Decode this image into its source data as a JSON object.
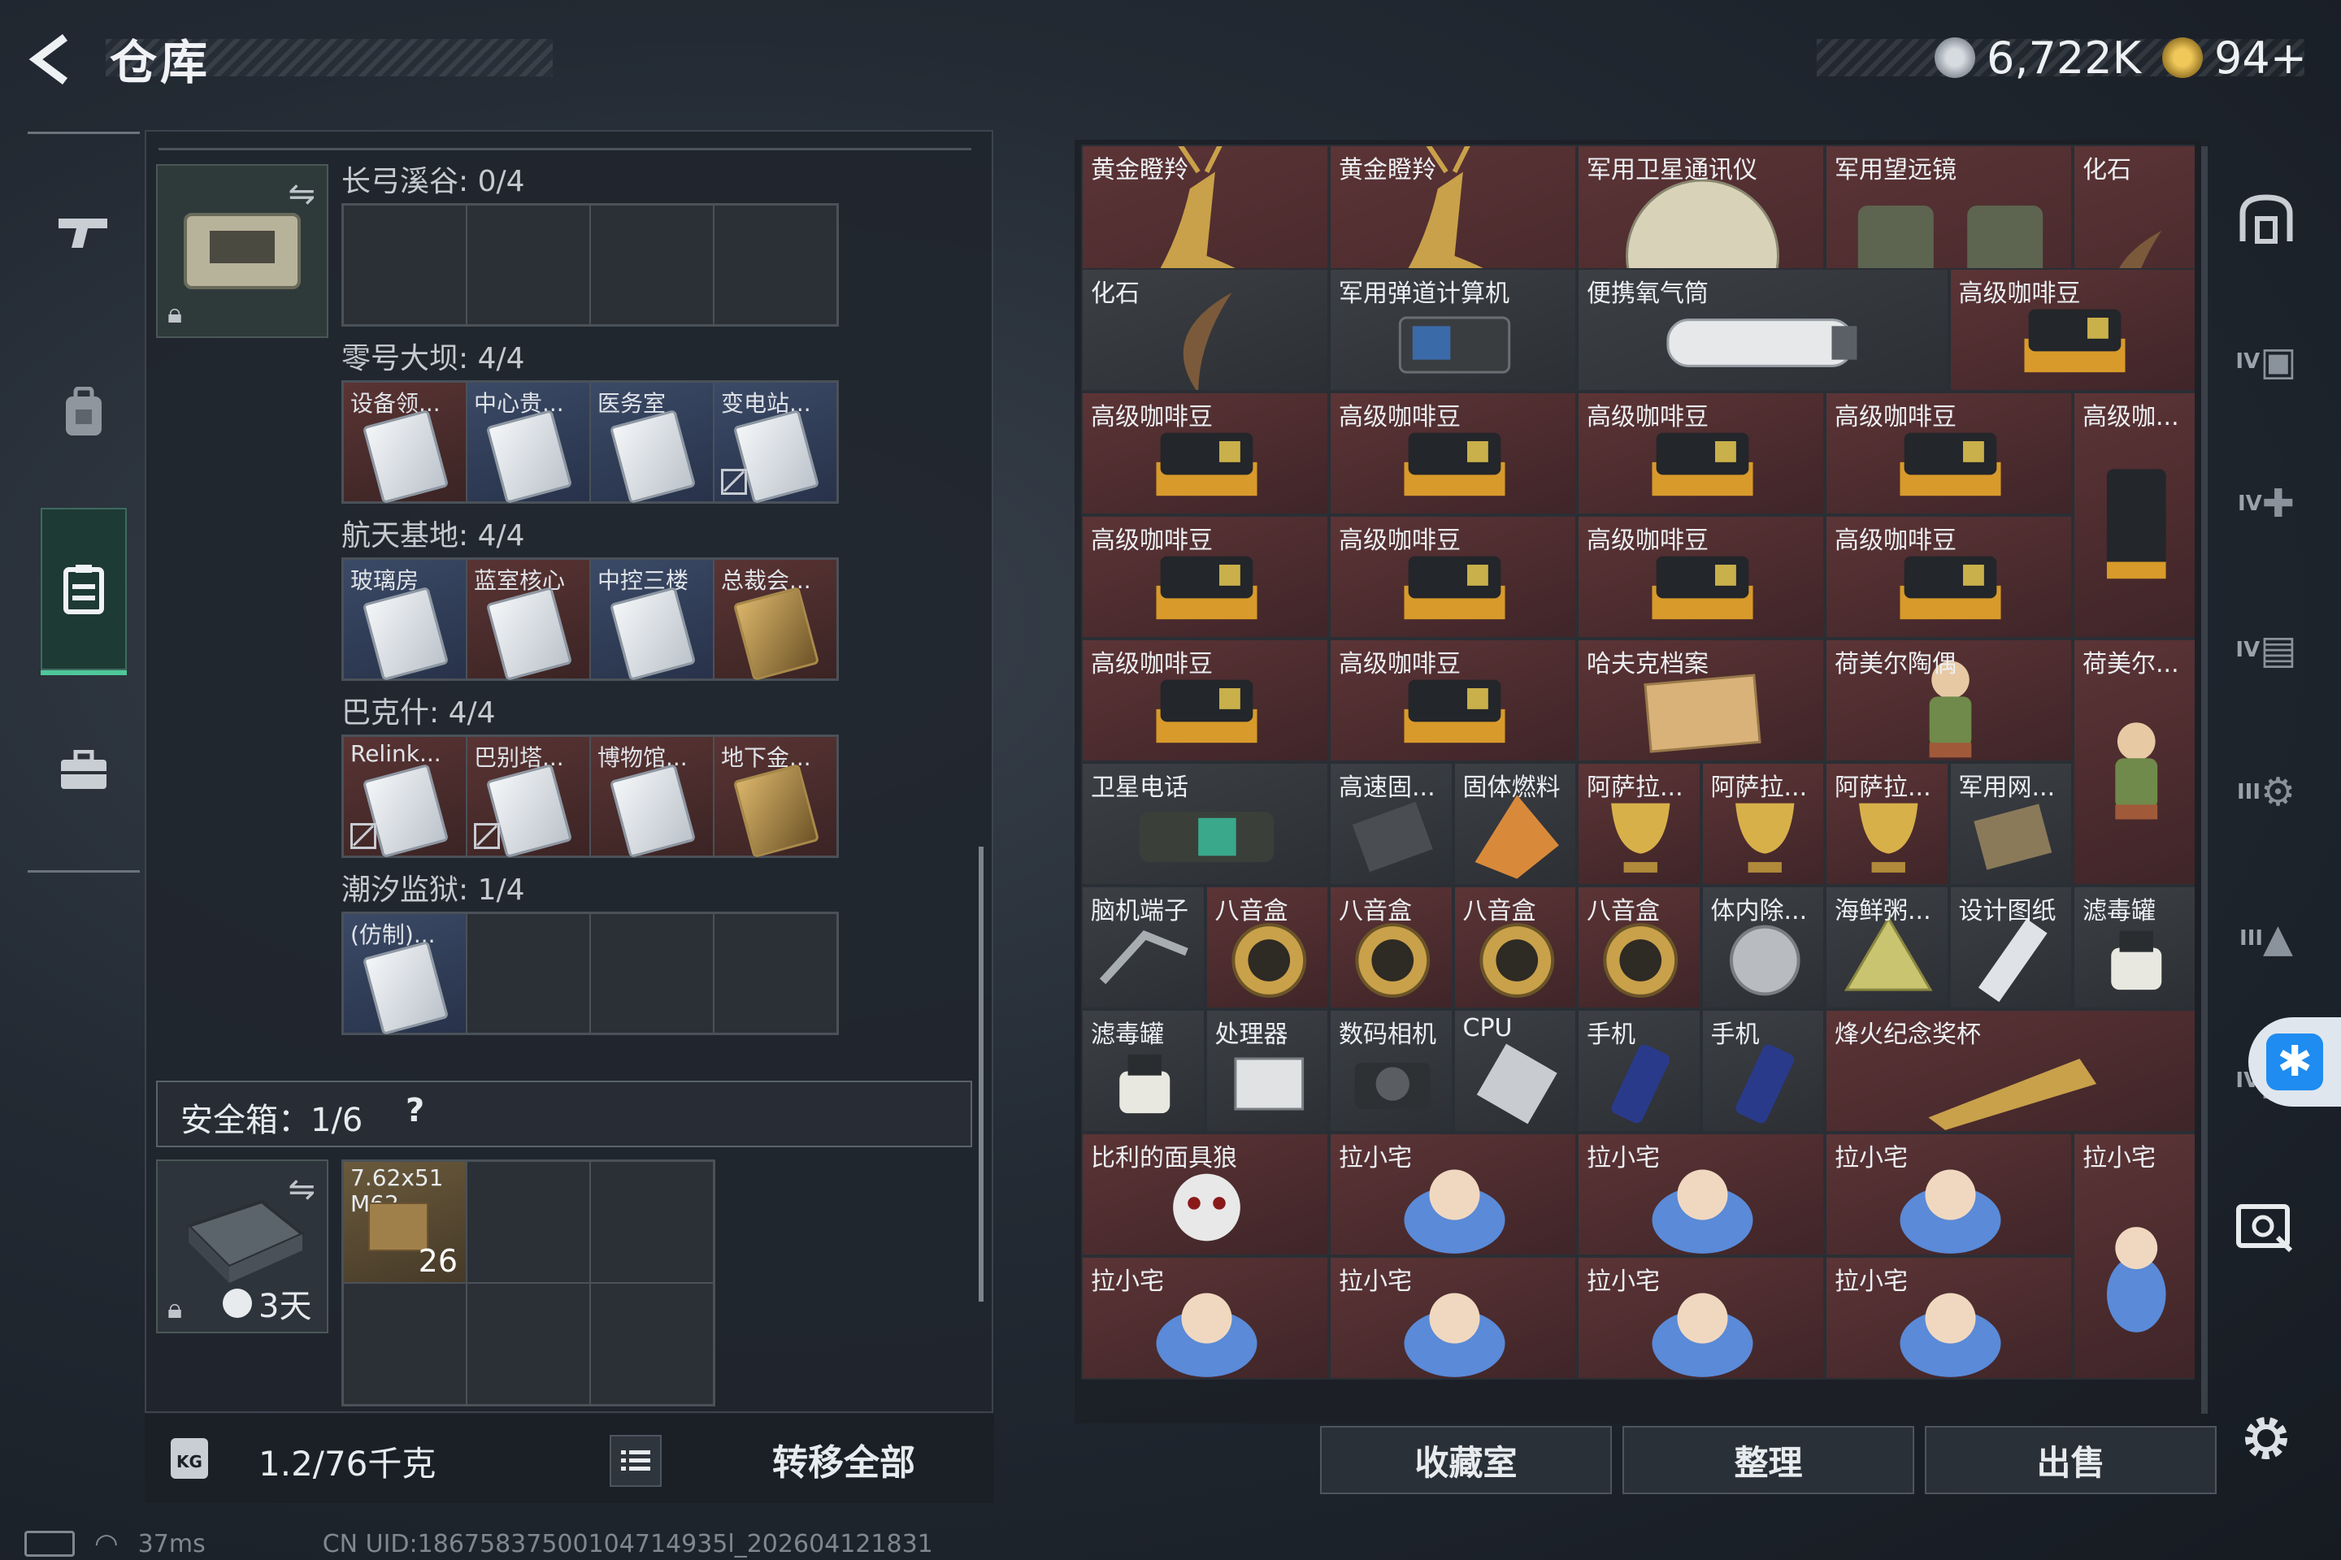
{
  "header": {
    "title": "仓库",
    "currency1": "6,722K",
    "currency2": "94+"
  },
  "storage": {
    "sections": [
      {
        "name": "长弓溪谷: 0/4",
        "slots": [
          {
            "label": ""
          },
          {
            "label": ""
          },
          {
            "label": ""
          },
          {
            "label": ""
          }
        ]
      },
      {
        "name": "零号大坝: 4/4",
        "slots": [
          {
            "label": "设备领..."
          },
          {
            "label": "中心贵..."
          },
          {
            "label": "医务室"
          },
          {
            "label": "变电站..."
          }
        ]
      },
      {
        "name": "航天基地: 4/4",
        "slots": [
          {
            "label": "玻璃房"
          },
          {
            "label": "蓝室核心"
          },
          {
            "label": "中控三楼"
          },
          {
            "label": "总裁会..."
          }
        ]
      },
      {
        "name": "巴克什: 4/4",
        "slots": [
          {
            "label": "Relink..."
          },
          {
            "label": "巴别塔..."
          },
          {
            "label": "博物馆..."
          },
          {
            "label": "地下金..."
          }
        ]
      },
      {
        "name": "潮汐监狱: 1/4",
        "slots": [
          {
            "label": "(仿制)..."
          },
          {
            "label": ""
          },
          {
            "label": ""
          },
          {
            "label": ""
          }
        ]
      }
    ],
    "safe_box": {
      "label": "安全箱：1/6",
      "help": "?",
      "timer": "3天",
      "ammo_name": "7.62x51 M62",
      "ammo_count": "26"
    },
    "weight": "1.2/76千克",
    "transfer_all": "转移全部"
  },
  "inventory": {
    "items": [
      {
        "name": "黄金瞪羚",
        "icon": "golden-gazelle"
      },
      {
        "name": "黄金瞪羚",
        "icon": "golden-gazelle"
      },
      {
        "name": "军用卫星通讯仪",
        "icon": "satellite-device"
      },
      {
        "name": "军用望远镜",
        "icon": "binoculars"
      },
      {
        "name": "化石",
        "icon": "fossil-claw"
      },
      {
        "name": "化石",
        "icon": "fossil-claw"
      },
      {
        "name": "军用弹道计算机",
        "icon": "ballistic-computer"
      },
      {
        "name": "便携氧气筒",
        "icon": "oxygen-tank"
      },
      {
        "name": "高级咖啡豆",
        "icon": "coffee-bag"
      },
      {
        "name": "高级咖啡豆",
        "icon": "coffee-bag"
      },
      {
        "name": "高级咖啡豆",
        "icon": "coffee-bag"
      },
      {
        "name": "高级咖啡豆",
        "icon": "coffee-bag"
      },
      {
        "name": "高级咖啡豆",
        "icon": "coffee-bag"
      },
      {
        "name": "高级咖...",
        "icon": "coffee-bag-tall"
      },
      {
        "name": "高级咖啡豆",
        "icon": "coffee-bag"
      },
      {
        "name": "高级咖啡豆",
        "icon": "coffee-bag"
      },
      {
        "name": "高级咖啡豆",
        "icon": "coffee-bag"
      },
      {
        "name": "高级咖啡豆",
        "icon": "coffee-bag"
      },
      {
        "name": "高级咖啡豆",
        "icon": "coffee-bag"
      },
      {
        "name": "高级咖啡豆",
        "icon": "coffee-bag"
      },
      {
        "name": "哈夫克档案",
        "icon": "file-folder"
      },
      {
        "name": "荷美尔陶偶",
        "icon": "ceramic-figure"
      },
      {
        "name": "荷美尔...",
        "icon": "ceramic-figure"
      },
      {
        "name": "卫星电话",
        "icon": "satellite-phone"
      },
      {
        "name": "高速固...",
        "icon": "ssd"
      },
      {
        "name": "固体燃料",
        "icon": "solid-fuel"
      },
      {
        "name": "阿萨拉...",
        "icon": "gold-cup"
      },
      {
        "name": "阿萨拉...",
        "icon": "gold-cup"
      },
      {
        "name": "阿萨拉...",
        "icon": "gold-cup"
      },
      {
        "name": "军用网...",
        "icon": "network-module"
      },
      {
        "name": "脑机端子",
        "icon": "brain-terminal"
      },
      {
        "name": "八音盒",
        "icon": "music-box"
      },
      {
        "name": "八音盒",
        "icon": "music-box"
      },
      {
        "name": "八音盒",
        "icon": "music-box"
      },
      {
        "name": "八音盒",
        "icon": "music-box"
      },
      {
        "name": "体内除...",
        "icon": "implant-device"
      },
      {
        "name": "海鲜粥...",
        "icon": "seafood-pack"
      },
      {
        "name": "设计图纸",
        "icon": "blueprint"
      },
      {
        "name": "滤毒罐",
        "icon": "gas-filter"
      },
      {
        "name": "滤毒罐",
        "icon": "gas-filter"
      },
      {
        "name": "处理器",
        "icon": "processor-board"
      },
      {
        "name": "数码相机",
        "icon": "camera"
      },
      {
        "name": "CPU",
        "icon": "cpu-chip"
      },
      {
        "name": "手机",
        "icon": "phone"
      },
      {
        "name": "手机",
        "icon": "phone"
      },
      {
        "name": "烽火纪念奖杯",
        "icon": "trophy"
      },
      {
        "name": "比利的面具狼",
        "icon": "billy-mask"
      },
      {
        "name": "拉小宅",
        "icon": "plush-doll"
      },
      {
        "name": "拉小宅",
        "icon": "plush-doll"
      },
      {
        "name": "拉小宅",
        "icon": "plush-doll"
      },
      {
        "name": "拉小宅",
        "icon": "plush-doll-tall"
      },
      {
        "name": "拉小宅",
        "icon": "plush-doll"
      },
      {
        "name": "拉小宅",
        "icon": "plush-doll"
      },
      {
        "name": "拉小宅",
        "icon": "plush-doll"
      },
      {
        "name": "拉小宅",
        "icon": "plush-doll"
      }
    ],
    "buttons": {
      "collection": "收藏室",
      "sort": "整理",
      "sell": "出售"
    }
  },
  "right_filters": [
    "IV",
    "IV",
    "IV",
    "III",
    "III",
    "IV",
    "IV"
  ],
  "status": {
    "ping": "37ms",
    "uid": "CN UID:18675837500104714935l_202604121831"
  },
  "colors": {
    "accent": "#4fc79b",
    "gold_item_bg": "#5c3436",
    "accessibility": "#1e8cf0"
  }
}
